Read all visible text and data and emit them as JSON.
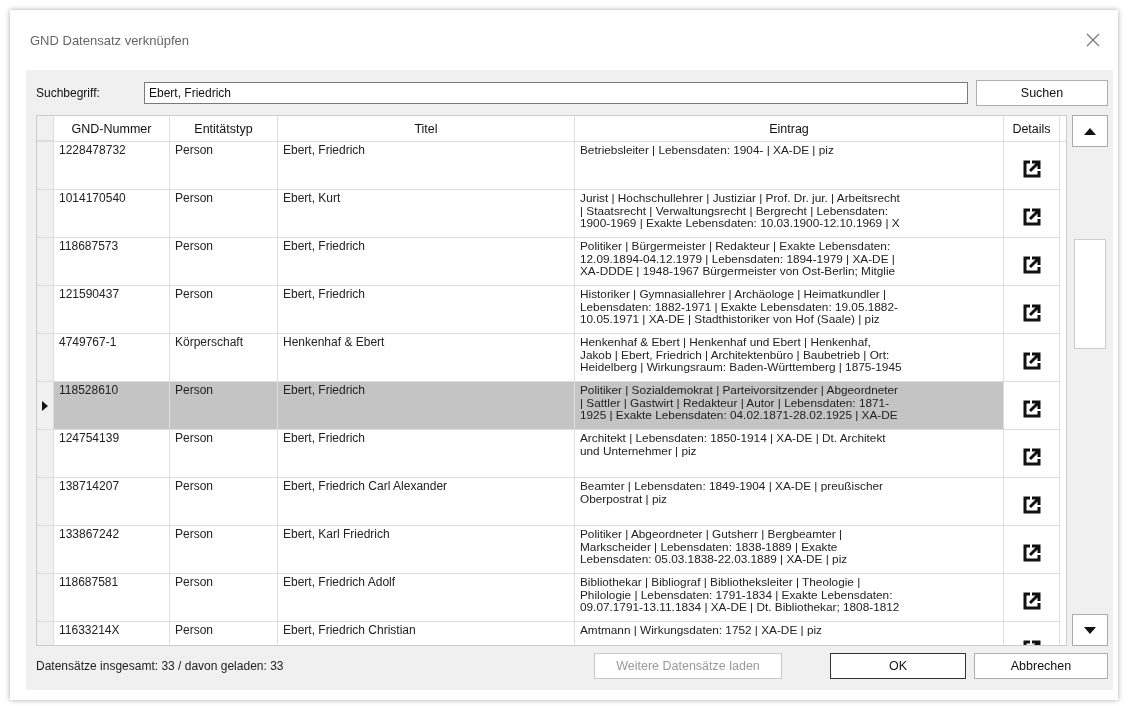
{
  "window": {
    "title": "GND Datensatz verknüpfen"
  },
  "search": {
    "label": "Suchbegriff:",
    "value": "Ebert, Friedrich",
    "button": "Suchen"
  },
  "table": {
    "columns": [
      "GND-Nummer",
      "Entitätstyp",
      "Titel",
      "Eintrag",
      "Details"
    ],
    "rows": [
      {
        "gnd": "1228478732",
        "type": "Person",
        "title": "Ebert, Friedrich",
        "entry": "Betriebsleiter | Lebensdaten: 1904- | XA-DE | piz",
        "selected": false
      },
      {
        "gnd": "1014170540",
        "type": "Person",
        "title": "Ebert, Kurt",
        "entry": "Jurist | Hochschullehrer | Justiziar | Prof. Dr. jur. | Arbeitsrecht\n| Staatsrecht | Verwaltungsrecht | Bergrecht | Lebensdaten:\n1900-1969 | Exakte Lebensdaten: 10.03.1900-12.10.1969 | X",
        "selected": false
      },
      {
        "gnd": "118687573",
        "type": "Person",
        "title": "Ebert, Friedrich",
        "entry": "Politiker | Bürgermeister | Redakteur | Exakte Lebensdaten:\n12.09.1894-04.12.1979 | Lebensdaten: 1894-1979 | XA-DE |\nXA-DDDE | 1948-1967 Bürgermeister von Ost-Berlin; Mitglie",
        "selected": false
      },
      {
        "gnd": "121590437",
        "type": "Person",
        "title": "Ebert, Friedrich",
        "entry": "Historiker | Gymnasiallehrer | Archäologe | Heimatkundler |\nLebensdaten: 1882-1971 | Exakte Lebensdaten: 19.05.1882-\n10.05.1971 | XA-DE | Stadthistoriker von Hof (Saale) | piz",
        "selected": false
      },
      {
        "gnd": "4749767-1",
        "type": "Körperschaft",
        "title": "Henkenhaf & Ebert",
        "entry": "Henkenhaf & Ebert | Henkenhaf und Ebert | Henkenhaf,\nJakob | Ebert, Friedrich | Architektenbüro | Baubetrieb | Ort:\nHeidelberg | Wirkungsraum: Baden-Württemberg | 1875-1945",
        "selected": false
      },
      {
        "gnd": "118528610",
        "type": "Person",
        "title": "Ebert, Friedrich",
        "entry": "Politiker | Sozialdemokrat | Parteivorsitzender | Abgeordneter\n| Sattler | Gastwirt | Redakteur | Autor | Lebensdaten: 1871-\n1925 | Exakte Lebensdaten: 04.02.1871-28.02.1925 | XA-DE",
        "selected": true
      },
      {
        "gnd": "124754139",
        "type": "Person",
        "title": "Ebert, Friedrich",
        "entry": "Architekt | Lebensdaten: 1850-1914 | XA-DE | Dt. Architekt\nund Unternehmer | piz",
        "selected": false
      },
      {
        "gnd": "138714207",
        "type": "Person",
        "title": "Ebert, Friedrich Carl Alexander",
        "entry": "Beamter | Lebensdaten: 1849-1904 | XA-DE | preußischer\nOberpostrat | piz",
        "selected": false
      },
      {
        "gnd": "133867242",
        "type": "Person",
        "title": "Ebert, Karl Friedrich",
        "entry": "Politiker | Abgeordneter | Gutsherr | Bergbeamter |\nMarkscheider | Lebensdaten: 1838-1889 | Exakte\nLebensdaten: 05.03.1838-22.03.1889 | XA-DE | piz",
        "selected": false
      },
      {
        "gnd": "118687581",
        "type": "Person",
        "title": "Ebert, Friedrich Adolf",
        "entry": "Bibliothekar | Bibliograf | Bibliotheksleiter | Theologie |\nPhilologie | Lebensdaten: 1791-1834 | Exakte Lebensdaten:\n09.07.1791-13.11.1834 | XA-DE | Dt. Bibliothekar; 1808-1812",
        "selected": false
      },
      {
        "gnd": "11633214X",
        "type": "Person",
        "title": "Ebert, Friedrich Christian",
        "entry": "Amtmann | Wirkungsdaten: 1752 | XA-DE | piz",
        "selected": false
      }
    ]
  },
  "footer": {
    "status": "Datensätze insgesamt: 33 / davon geladen: 33",
    "load_more": {
      "label": "Weitere Datensätze laden",
      "disabled": true
    },
    "ok": "OK",
    "cancel": "Abbrechen"
  }
}
